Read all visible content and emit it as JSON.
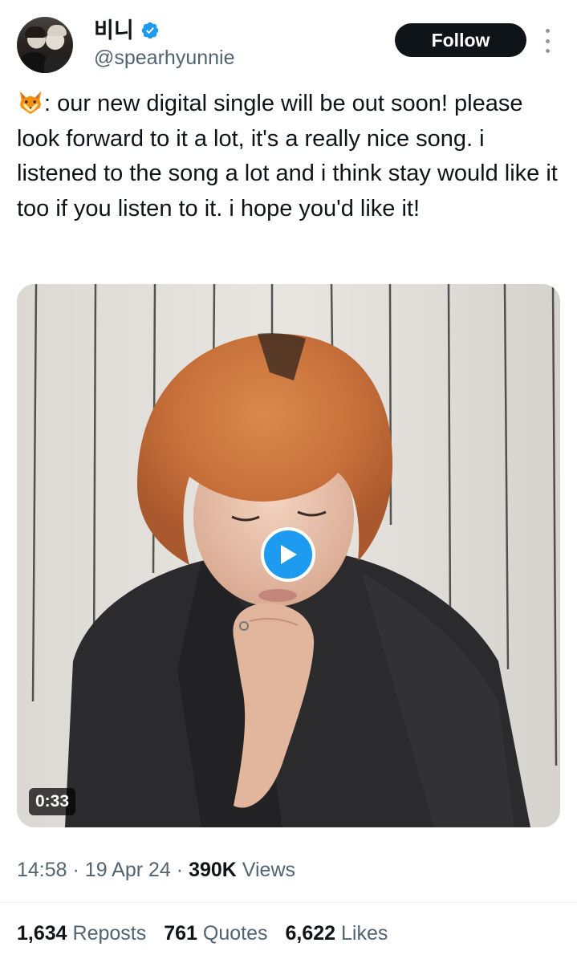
{
  "author": {
    "display_name": "비니",
    "handle": "@spearhyunnie",
    "verified_icon": "verified-badge-icon",
    "avatar_icon": "profile-photo"
  },
  "header": {
    "follow_label": "Follow",
    "more_icon": "more-options-icon"
  },
  "tweet": {
    "emoji": "fox-emoji",
    "text": ": our new digital single will be out soon! please look forward to it a lot, it's a really nice song. i listened to the song a lot and i think stay would like it too if you listen to it. i hope you'd like it!"
  },
  "media": {
    "type": "video",
    "play_icon": "play-icon",
    "duration": "0:33"
  },
  "meta": {
    "time": "14:58",
    "separator": "·",
    "date": "19 Apr 24",
    "views_count": "390K",
    "views_label": "Views"
  },
  "stats": {
    "reposts_count": "1,634",
    "reposts_label": "Reposts",
    "quotes_count": "761",
    "quotes_label": "Quotes",
    "likes_count": "6,622",
    "likes_label": "Likes"
  },
  "colors": {
    "accent": "#1d9bf0",
    "text_primary": "#0f1419",
    "text_secondary": "#536471"
  }
}
